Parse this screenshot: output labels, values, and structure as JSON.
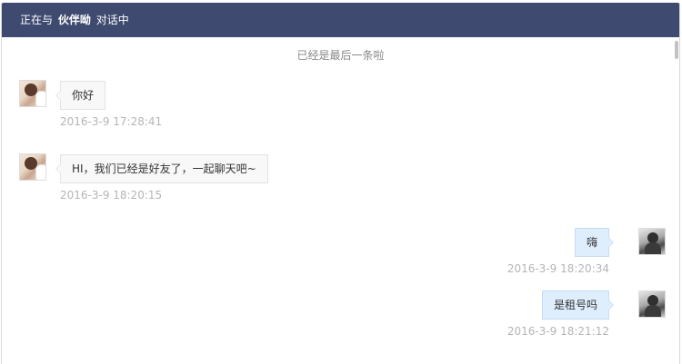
{
  "header": {
    "prefix": "正在与",
    "contact_name": "伙伴呦",
    "suffix": "对话中"
  },
  "notice": "已经是最后一条啦",
  "messages": [
    {
      "side": "left",
      "text": "你好",
      "time": "2016-3-9 17:28:41"
    },
    {
      "side": "left",
      "text": "HI，我们已经是好友了，一起聊天吧~",
      "time": "2016-3-9 18:20:15"
    },
    {
      "side": "right",
      "text": "嗨",
      "time": "2016-3-9 18:20:34"
    },
    {
      "side": "right",
      "text": "是租号吗",
      "time": "2016-3-9 18:21:12"
    }
  ],
  "colors": {
    "header_bg": "#3e4a6f",
    "left_bubble_bg": "#f8f8f8",
    "right_bubble_bg": "#dfeefd",
    "timestamp": "#b5b5b5"
  }
}
